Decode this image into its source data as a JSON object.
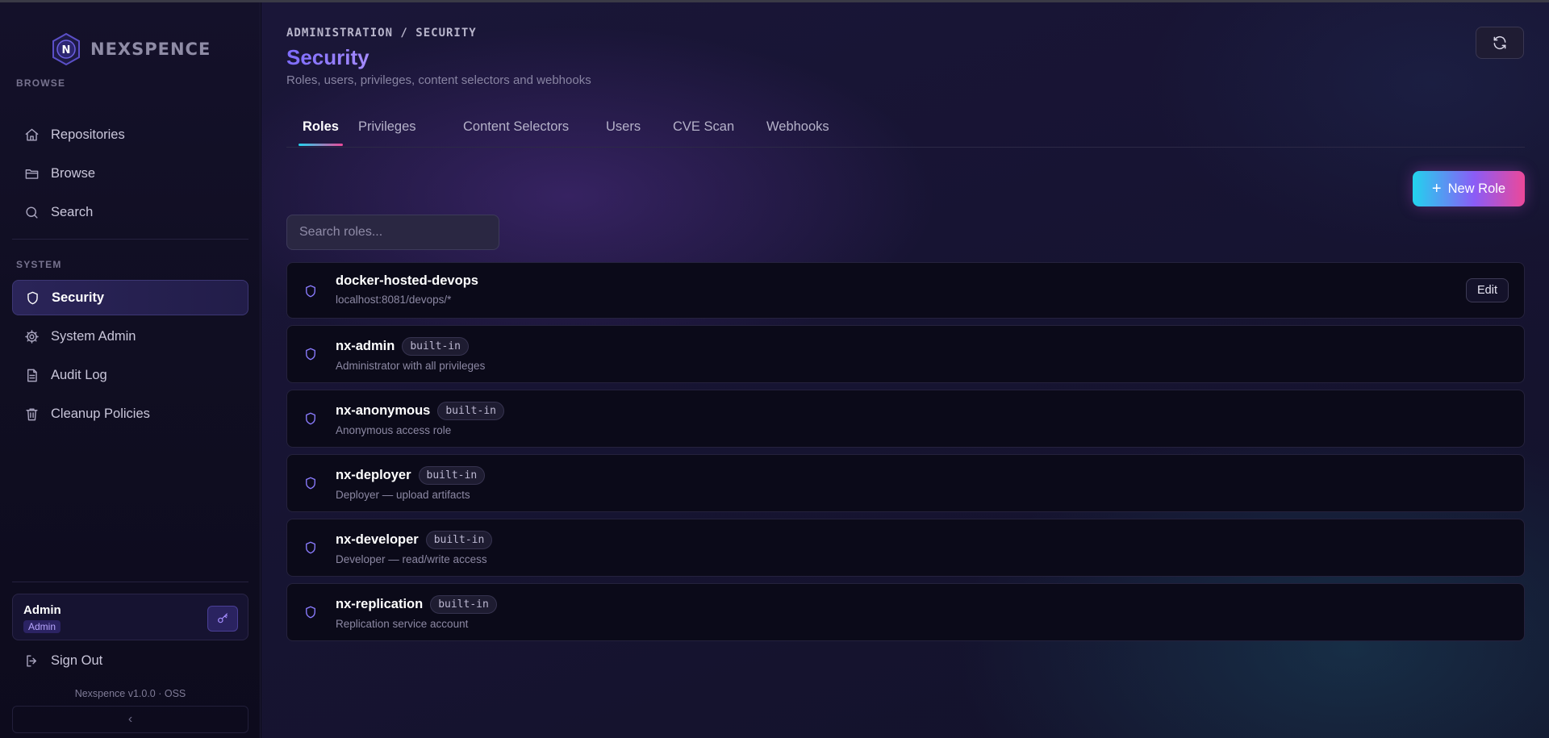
{
  "app": {
    "name": "NEXSPENCE",
    "logo_letter": "N",
    "version": "Nexspence v1.0.0 · OSS"
  },
  "sidebar": {
    "browse_label": "BROWSE",
    "system_label": "SYSTEM",
    "browse_items": [
      {
        "label": "Repositories",
        "icon": "home-icon"
      },
      {
        "label": "Browse",
        "icon": "folder-icon"
      },
      {
        "label": "Search",
        "icon": "search-icon"
      }
    ],
    "system_items": [
      {
        "label": "Security",
        "icon": "shield-icon",
        "active": true
      },
      {
        "label": "System Admin",
        "icon": "gear-icon"
      },
      {
        "label": "Audit Log",
        "icon": "document-icon"
      },
      {
        "label": "Cleanup Policies",
        "icon": "trash-icon"
      }
    ],
    "user": {
      "name": "Admin",
      "role": "Admin"
    },
    "sign_out": "Sign Out",
    "collapse": "‹"
  },
  "header": {
    "breadcrumb": "ADMINISTRATION / SECURITY",
    "title": "Security",
    "subtitle": "Roles, users, privileges, content selectors and webhooks"
  },
  "tabs": [
    {
      "label": "Roles",
      "active": true
    },
    {
      "label": "Privileges"
    },
    {
      "label": "Content Selectors"
    },
    {
      "label": "Users"
    },
    {
      "label": "CVE Scan"
    },
    {
      "label": "Webhooks"
    }
  ],
  "actions": {
    "new_role": "New Role",
    "new_role_icon": "+",
    "edit": "Edit"
  },
  "search": {
    "placeholder": "Search roles..."
  },
  "roles": [
    {
      "name": "docker-hosted-devops",
      "badge": "",
      "description": "localhost:8081/devops/*"
    },
    {
      "name": "nx-admin",
      "badge": "built-in",
      "description": "Administrator with all privileges"
    },
    {
      "name": "nx-anonymous",
      "badge": "built-in",
      "description": "Anonymous access role"
    },
    {
      "name": "nx-deployer",
      "badge": "built-in",
      "description": "Deployer — upload artifacts"
    },
    {
      "name": "nx-developer",
      "badge": "built-in",
      "description": "Developer — read/write access"
    },
    {
      "name": "nx-replication",
      "badge": "built-in",
      "description": "Replication service account"
    }
  ],
  "colors": {
    "accent": "#8b7cff",
    "gradient_start": "#22d3ee",
    "gradient_end": "#ec4899"
  }
}
